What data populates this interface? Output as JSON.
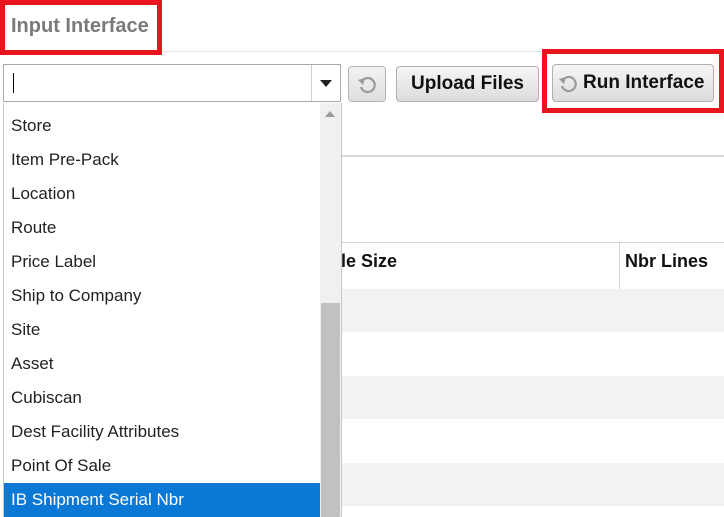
{
  "header": {
    "title": "Input Interface"
  },
  "combo": {
    "value": "",
    "placeholder": ""
  },
  "toolbar": {
    "upload_label": "Upload Files",
    "run_label": "Run Interface"
  },
  "table": {
    "columns": [
      "le Size",
      "Nbr Lines"
    ]
  },
  "dropdown": {
    "items": [
      "Store",
      "Item Pre-Pack",
      "Location",
      "Route",
      "Price Label",
      "Ship to Company",
      "Site",
      "Asset",
      "Cubiscan",
      "Dest Facility Attributes",
      "Point Of Sale",
      "IB Shipment Serial Nbr"
    ],
    "selected": "IB Shipment Serial Nbr"
  },
  "colors": {
    "highlight": "#e8141e",
    "selection": "#0a78d4"
  },
  "icons": {
    "refresh": "refresh-icon",
    "dropdown": "chevron-down-icon"
  }
}
